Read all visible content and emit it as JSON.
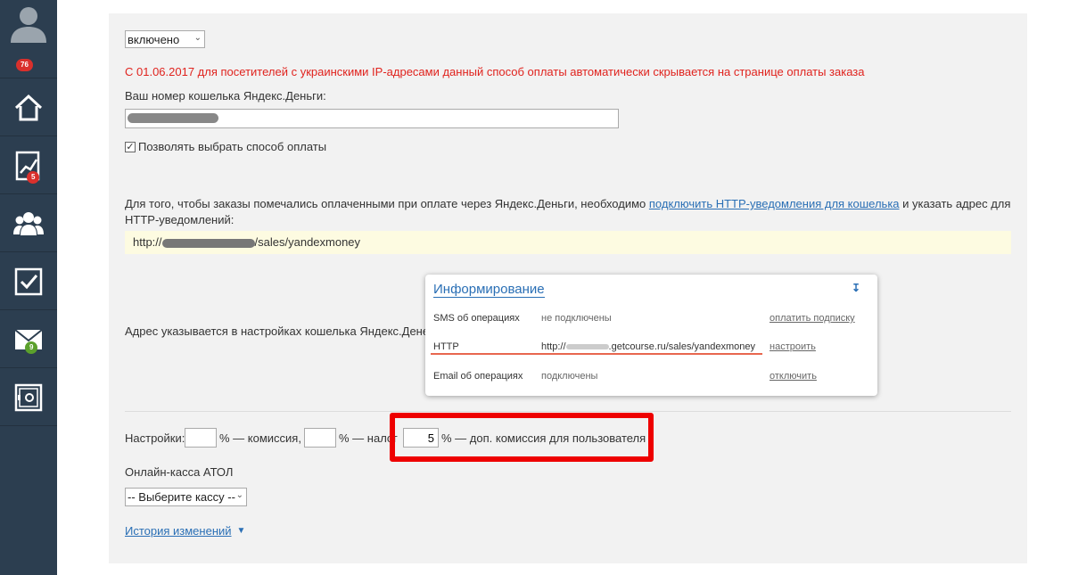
{
  "sidebar": {
    "avatar_badge": "76",
    "stats_badge": "5",
    "mail_badge": "9"
  },
  "form": {
    "status_select": "включено",
    "warning": "С 01.06.2017 для посетителей с украинскими IP-адресами данный способ оплаты автоматически скрывается на странице оплаты заказа",
    "wallet_label": "Ваш номер кошелька Яндекс.Деньги:",
    "allow_choice_label": "Позволять выбрать способ оплаты",
    "http_note_prefix": "Для того, чтобы заказы помечались оплаченными при оплате через Яндекс.Деньги, необходимо ",
    "http_note_link": "подключить HTTP-уведомления для кошелька",
    "http_note_suffix": " и указать адрес для HTTP-уведомлений:",
    "url_prefix": "http://",
    "url_suffix": "/sales/yandexmoney",
    "address_label": "Адрес указывается в настройках кошелька Яндекс.Денег:"
  },
  "card": {
    "title": "Информирование",
    "rows": [
      {
        "name": "SMS об операциях",
        "value": "не подключены",
        "action": "оплатить подписку"
      },
      {
        "name": "HTTP",
        "value_prefix": "http://",
        "value_suffix": ".getcourse.ru/sales/yandexmoney",
        "action": "настроить"
      },
      {
        "name": "Email об операциях",
        "value": "подключены",
        "action": "отключить"
      }
    ]
  },
  "settings": {
    "label": "Настройки:",
    "commission_suffix": "% — комиссия,",
    "tax_suffix": "% — налог",
    "extra_value": "5",
    "extra_suffix": "% — доп. комиссия для пользователя"
  },
  "kassa": {
    "label": "Онлайн-касса АТОЛ",
    "select": "-- Выберите кассу --"
  },
  "history_link": "История изменений",
  "colors": {
    "sidebar": "#2c3e50",
    "warning": "#e0231e",
    "link": "#2a6fb5",
    "highlight": "#ee0000"
  }
}
